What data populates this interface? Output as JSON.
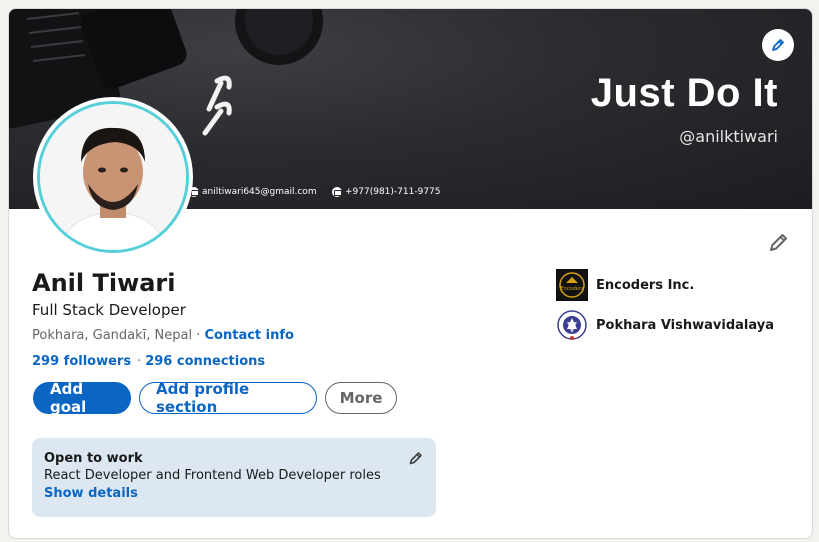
{
  "banner": {
    "title": "Just Do It",
    "handle": "@anilktiwari",
    "email": "aniltiwari645@gmail.com",
    "phone": "+977(981)-711-9775",
    "edit_icon": "pencil-icon"
  },
  "profile": {
    "name": "Anil Tiwari",
    "headline": "Full Stack Developer",
    "location": "Pokhara, Gandakī, Nepal",
    "separator": " · ",
    "contact_info": "Contact info",
    "followers": "299 followers",
    "stats_separator": "·",
    "connections": "296 connections"
  },
  "actions": {
    "add_goal": "Add goal",
    "add_profile_section": "Add profile section",
    "more": "More"
  },
  "open_to_work": {
    "title": "Open to work",
    "text": "React Developer and Frontend Web Developer roles",
    "link": "Show details"
  },
  "orgs": [
    {
      "name": "Encoders Inc.",
      "logo_text": "Encoders"
    },
    {
      "name": "Pokhara Vishwavidalaya"
    }
  ],
  "colors": {
    "accent": "#0a66c2",
    "avatar_ring": "#56d0d8",
    "open_to_work_bg": "#dde7f1"
  }
}
